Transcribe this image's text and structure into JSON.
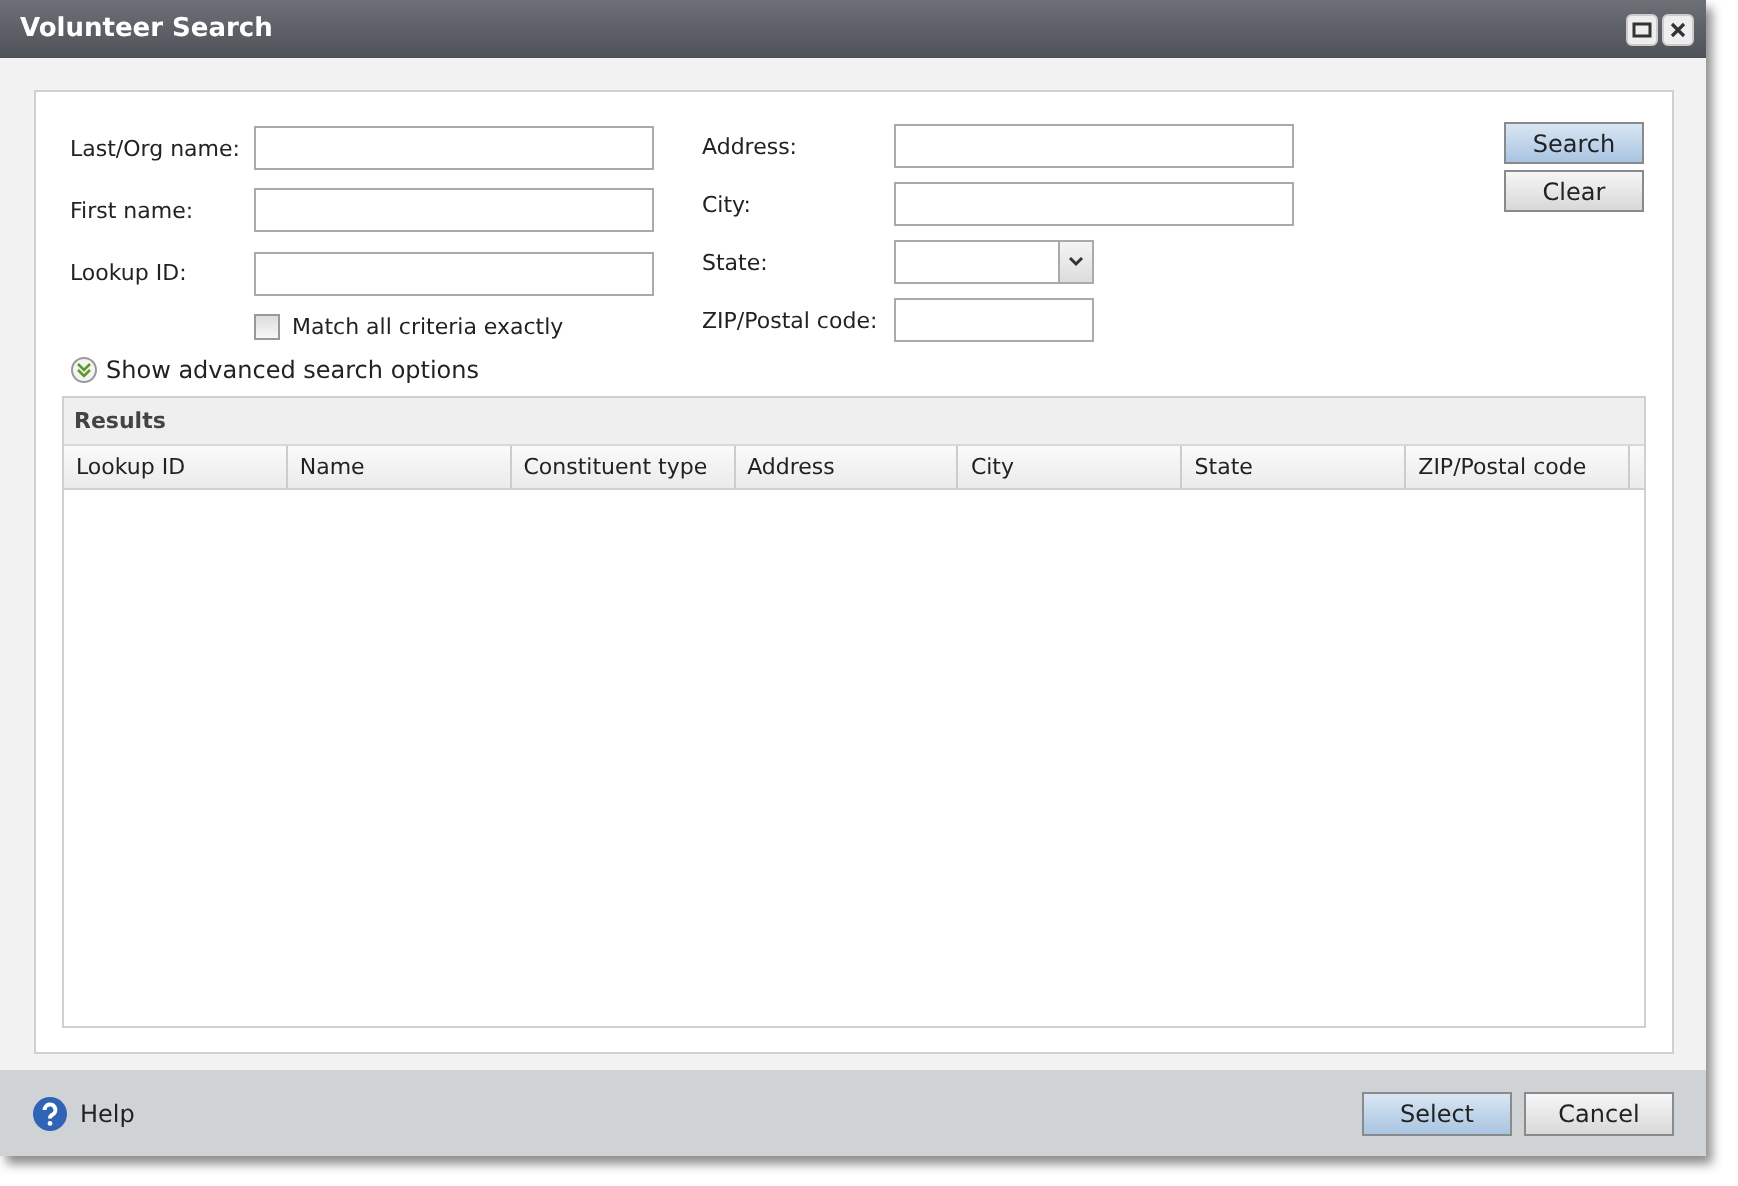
{
  "window": {
    "title": "Volunteer Search"
  },
  "fields_left": [
    {
      "label": "Last/Org name:",
      "kind": "text"
    },
    {
      "label": "First name:",
      "kind": "text"
    },
    {
      "label": "Lookup ID:",
      "kind": "text"
    }
  ],
  "match_all": {
    "label": "Match all criteria exactly",
    "checked": false
  },
  "fields_right": [
    {
      "label": "Address:",
      "kind": "text"
    },
    {
      "label": "City:",
      "kind": "text"
    },
    {
      "label": "State:",
      "kind": "select"
    },
    {
      "label": "ZIP/Postal code:",
      "kind": "short"
    }
  ],
  "search_buttons": [
    {
      "label": "Search",
      "primary": true
    },
    {
      "label": "Clear",
      "primary": false
    }
  ],
  "advanced": {
    "label": "Show advanced search options",
    "expanded": false
  },
  "results": {
    "title": "Results",
    "columns": [
      "Lookup ID",
      "Name",
      "Constituent type",
      "Address",
      "City",
      "State",
      "ZIP/Postal code"
    ]
  },
  "help": {
    "label": "Help"
  },
  "footer_buttons": [
    {
      "label": "Select",
      "primary": true
    },
    {
      "label": "Cancel",
      "primary": false
    }
  ]
}
